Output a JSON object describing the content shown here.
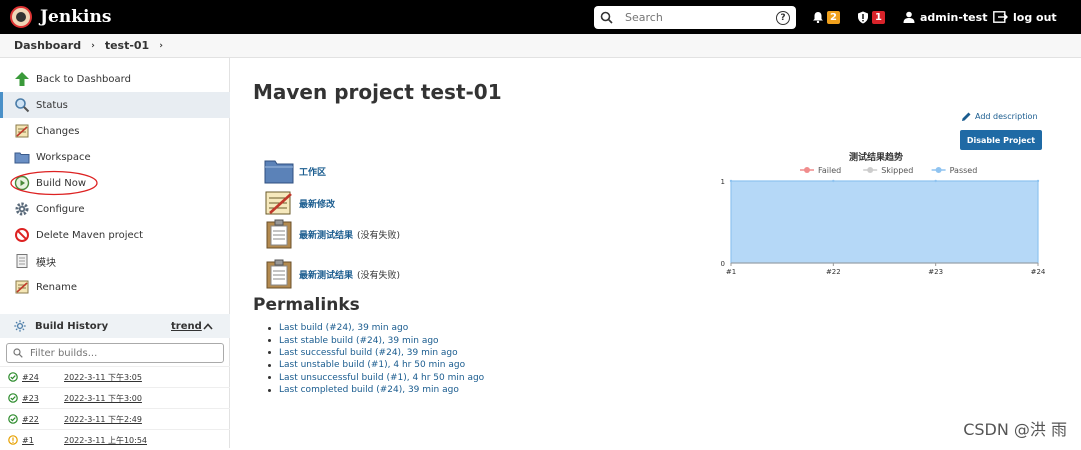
{
  "header": {
    "brand": "Jenkins",
    "search_placeholder": "Search",
    "help": "?",
    "notifications_count": "2",
    "security_count": "1",
    "user": "admin-test",
    "logout": "log out"
  },
  "breadcrumb": {
    "items": [
      "Dashboard",
      "test-01"
    ]
  },
  "sidebar": {
    "items": [
      {
        "label": "Back to Dashboard",
        "icon": "arrow-up-icon"
      },
      {
        "label": "Status",
        "icon": "search-icon"
      },
      {
        "label": "Changes",
        "icon": "notepad-icon"
      },
      {
        "label": "Workspace",
        "icon": "folder-icon"
      },
      {
        "label": "Build Now",
        "icon": "clock-play-icon"
      },
      {
        "label": "Configure",
        "icon": "gear-icon"
      },
      {
        "label": "Delete Maven project",
        "icon": "no-entry-icon"
      },
      {
        "label": "模块",
        "icon": "document-icon"
      },
      {
        "label": "Rename",
        "icon": "notepad-icon"
      }
    ],
    "build_history": {
      "title": "Build History",
      "trend": "trend",
      "filter_placeholder": "Filter builds...",
      "builds": [
        {
          "num": "#24",
          "time": "2022-3-11 下午3:05",
          "status": "success"
        },
        {
          "num": "#23",
          "time": "2022-3-11 下午3:00",
          "status": "success"
        },
        {
          "num": "#22",
          "time": "2022-3-11 下午2:49",
          "status": "success"
        },
        {
          "num": "#1",
          "time": "2022-3-11 上午10:54",
          "status": "unstable"
        }
      ]
    }
  },
  "main": {
    "title": "Maven project test-01",
    "add_description": "Add description",
    "disable_button": "Disable Project",
    "links": [
      {
        "label": "工作区",
        "note": ""
      },
      {
        "label": "最新修改",
        "note": ""
      },
      {
        "label": "最新测试结果",
        "note": "(没有失败)"
      },
      {
        "label": "最新测试结果",
        "note": "(没有失败)"
      }
    ],
    "permalinks_title": "Permalinks",
    "permalinks": [
      "Last build (#24), 39 min ago",
      "Last stable build (#24), 39 min ago",
      "Last successful build (#24), 39 min ago",
      "Last unstable build (#1), 4 hr 50 min ago",
      "Last unsuccessful build (#1), 4 hr 50 min ago",
      "Last completed build (#24), 39 min ago"
    ]
  },
  "chart_data": {
    "type": "area",
    "title": "测试结果趋势",
    "categories": [
      "#1",
      "#22",
      "#23",
      "#24"
    ],
    "series": [
      {
        "name": "Failed",
        "color": "#f08c8c",
        "values": [
          0,
          0,
          0,
          0
        ]
      },
      {
        "name": "Skipped",
        "color": "#cccccc",
        "values": [
          0,
          0,
          0,
          0
        ]
      },
      {
        "name": "Passed",
        "color": "#8fc3f0",
        "values": [
          1,
          1,
          1,
          1
        ]
      }
    ],
    "ylim": [
      0,
      1
    ],
    "yticks": [
      "0",
      "1"
    ],
    "legend": "top"
  },
  "watermark": "CSDN @洪 雨"
}
